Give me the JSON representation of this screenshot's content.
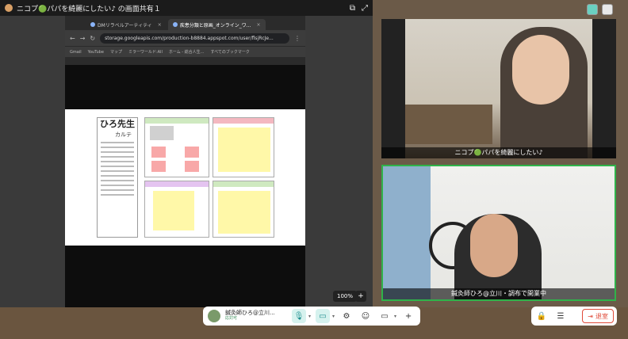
{
  "title_bar": {
    "title": "ニコプ🟢パパを綺麗にしたい♪ の画面共有１"
  },
  "browser": {
    "tabs": [
      {
        "label": "DMリラベルアーティティ"
      },
      {
        "label": "疾患分類と原画_オンライン_ワ..."
      }
    ],
    "url": "storage.googleapis.com/production-b8884.appspot.com/user/flsjRcJe...",
    "bookmarks": [
      "Gmail",
      "YouTube",
      "マップ",
      "ミラーワールド:All",
      "ホーム - 総合人生...",
      "すべてのブックマーク"
    ]
  },
  "document": {
    "name_line": "ひろ先生",
    "sub_line": "カルテ"
  },
  "viewer": {
    "zoom": "100%",
    "zoom_plus": "+"
  },
  "videos": [
    {
      "name": "ニコプ🟢パパを綺麗にしたい♪"
    },
    {
      "name": "鍼灸師ひろ@立川・調布で開業中"
    }
  ],
  "control_bar": {
    "user_name": "鍼灸師ひろ@立川...",
    "user_status": "応対可"
  },
  "leave": {
    "label": "退室"
  }
}
